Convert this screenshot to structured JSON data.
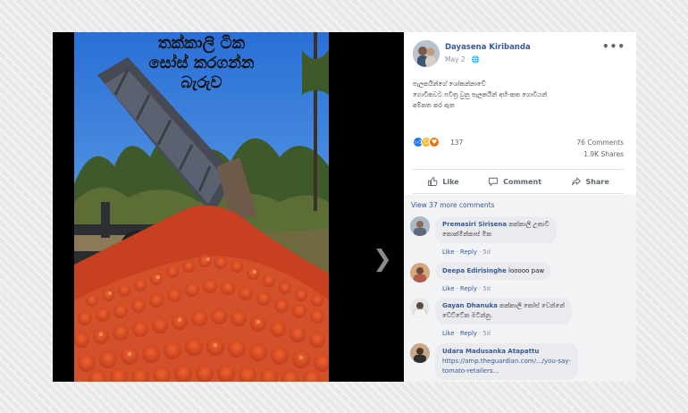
{
  "photo": {
    "overlay_lines": [
      "තක්කාලි ටික",
      "සෝස් කරගන්න",
      "බැරුව"
    ]
  },
  "post": {
    "author": "Dayasena Kiribanda",
    "date": "May 2",
    "privacy_icon": "globe-icon",
    "more_icon": "•••",
    "body_lines": [
      "පැලකයින්ගේ ශෝකන්නාවේ",
      "ගොවිකවට පවිත්‍ර වුනු පැලකයින් අහි-කත ගොවියන්",
      "අම්කත කර ඇත"
    ],
    "reactions": {
      "icons": [
        "like",
        "haha",
        "love"
      ],
      "count": "137",
      "comments": "76 Comments",
      "shares": "1.9K Shares"
    },
    "actions": {
      "like": "Like",
      "comment": "Comment",
      "share": "Share"
    }
  },
  "comments": {
    "view_more": "View 37 more comments",
    "link_like": "Like",
    "link_reply": "Reply",
    "items": [
      {
        "name": "Premasiri Sirisena",
        "lines": [
          "කක්කාලි උකාවි",
          "කොක්මින්කාස් මික"
        ],
        "time": "5d"
      },
      {
        "name": "Deepa Edirisinghe",
        "lines": [
          "looooo paw"
        ],
        "time": "5d"
      },
      {
        "name": "Gayan Dhanuka",
        "lines": [
          "කක්කාලි කෝස් වෙන්නේ",
          "වේට්ටේක මටින්නු."
        ],
        "time": "5d"
      },
      {
        "name": "Udara Madusanka Atapattu",
        "lines": [
          "https://amp.theguardian.com/.../you-say-",
          "tomato-retailers..."
        ],
        "time": ""
      }
    ]
  },
  "colors": {
    "link": "#385898",
    "like_blue": "#1877f2",
    "haha_yellow": "#f7b125",
    "love_red": "#e9710f"
  }
}
